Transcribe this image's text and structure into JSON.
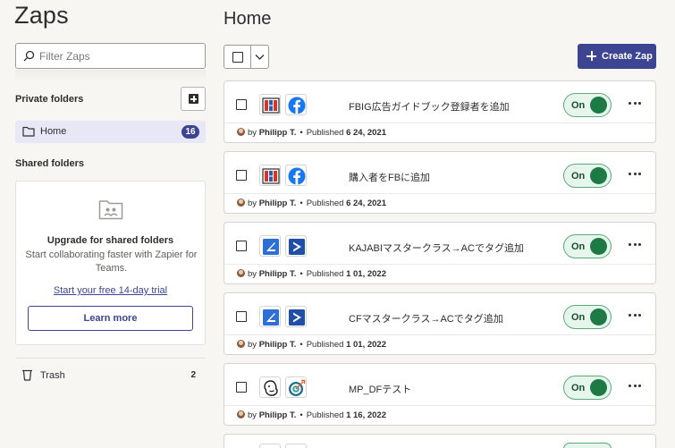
{
  "sidebar": {
    "title": "Zaps",
    "filter_placeholder": "Filter Zaps",
    "private_folders_label": "Private folders",
    "home_label": "Home",
    "home_count": "16",
    "shared_folders_label": "Shared folders",
    "upgrade": {
      "title": "Upgrade for shared folders",
      "description": "Start collaborating faster with Zapier for Teams.",
      "trial_link": "Start your free 14-day trial",
      "learn_more": "Learn more"
    },
    "trash_label": "Trash",
    "trash_count": "2"
  },
  "main": {
    "title": "Home",
    "create_label": "Create Zap",
    "zaps": [
      {
        "name": "FBIG広告ガイドブック登録者を追加",
        "icons": [
          "clickfunnels-icon",
          "facebook-icon"
        ],
        "status": "On",
        "by": "by",
        "owner": "Philipp T.",
        "published_label": "Published",
        "date": "6 24, 2021"
      },
      {
        "name": "購入者をFBに追加",
        "icons": [
          "clickfunnels-icon",
          "facebook-icon"
        ],
        "status": "On",
        "by": "by",
        "owner": "Philipp T.",
        "published_label": "Published",
        "date": "6 24, 2021"
      },
      {
        "name": "KAJABIマスタークラス→ACでタグ追加",
        "icons": [
          "kajabi-icon",
          "activecampaign-icon"
        ],
        "status": "On",
        "by": "by",
        "owner": "Philipp T.",
        "published_label": "Published",
        "date": "1 01, 2022"
      },
      {
        "name": "CFマスタークラス→ACでタグ追加",
        "icons": [
          "kajabi-icon",
          "activecampaign-icon"
        ],
        "status": "On",
        "by": "by",
        "owner": "Philipp T.",
        "published_label": "Published",
        "date": "1 01, 2022"
      },
      {
        "name": "MP_DFテスト",
        "icons": [
          "mailchimp-icon",
          "target-icon"
        ],
        "status": "On",
        "by": "by",
        "owner": "Philipp T.",
        "published_label": "Published",
        "date": "1 16, 2022"
      }
    ]
  },
  "colors": {
    "brand": "#3d4592",
    "toggle_on": "#1e7a45",
    "toggle_bg": "#e6f6ec",
    "facebook": "#1877f2",
    "clickfunnels": "#d8352a",
    "kajabi": "#2d6fd6",
    "activecampaign": "#1f4fa8"
  }
}
